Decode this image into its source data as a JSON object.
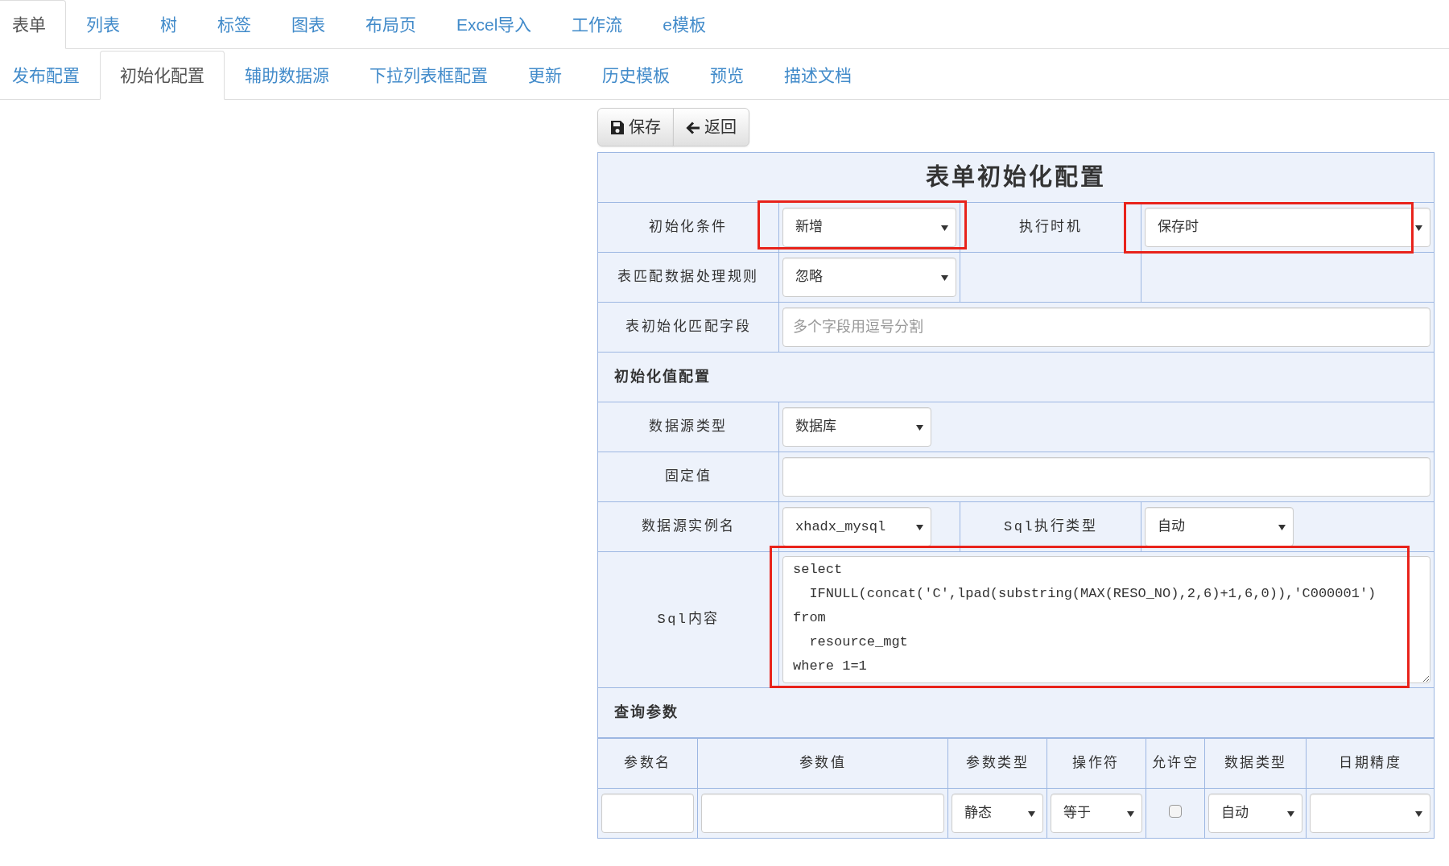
{
  "tabs": [
    {
      "label": "表单",
      "selected": true
    },
    {
      "label": "列表",
      "selected": false
    },
    {
      "label": "树",
      "selected": false
    },
    {
      "label": "标签",
      "selected": false
    },
    {
      "label": "图表",
      "selected": false
    },
    {
      "label": "布局页",
      "selected": false
    },
    {
      "label": "Excel导入",
      "selected": false
    },
    {
      "label": "工作流",
      "selected": false
    },
    {
      "label": "e模板",
      "selected": false
    }
  ],
  "subtabs": [
    {
      "label": "发布配置",
      "selected": false
    },
    {
      "label": "初始化配置",
      "selected": true
    },
    {
      "label": "辅助数据源",
      "selected": false
    },
    {
      "label": "下拉列表框配置",
      "selected": false
    },
    {
      "label": "更新",
      "selected": false
    },
    {
      "label": "历史模板",
      "selected": false
    },
    {
      "label": "预览",
      "selected": false
    },
    {
      "label": "描述文档",
      "selected": false
    }
  ],
  "toolbar": [
    {
      "kind": "save",
      "label": "保存"
    },
    {
      "kind": "back",
      "label": "返回"
    }
  ],
  "form": {
    "title": "表单初始化配置",
    "rows": [
      {
        "kind": "fields",
        "cells": [
          {
            "kind": "label",
            "text": "初始化条件"
          },
          {
            "kind": "select",
            "value": "新增",
            "highlighted": true
          },
          {
            "kind": "label",
            "text": "执行时机"
          },
          {
            "kind": "select",
            "value": "保存时",
            "highlighted": true
          }
        ]
      },
      {
        "kind": "fields",
        "cells": [
          {
            "kind": "label",
            "text": "表匹配数据处理规则"
          },
          {
            "kind": "select",
            "value": "忽略",
            "highlighted": false
          },
          {
            "kind": "blank"
          },
          {
            "kind": "blank"
          }
        ]
      },
      {
        "kind": "fields",
        "cells": [
          {
            "kind": "label",
            "text": "表初始化匹配字段"
          },
          {
            "kind": "input",
            "placeholder": "多个字段用逗号分割",
            "highlighted": false
          }
        ]
      },
      {
        "kind": "section",
        "title": "初始化值配置"
      },
      {
        "kind": "fields",
        "cells": [
          {
            "kind": "label",
            "text": "数据源类型"
          },
          {
            "kind": "select",
            "value": "数据库",
            "highlighted": false
          }
        ]
      },
      {
        "kind": "fields",
        "cells": [
          {
            "kind": "label",
            "text": "固定值"
          },
          {
            "kind": "input",
            "highlighted": false
          }
        ]
      },
      {
        "kind": "fields",
        "cells": [
          {
            "kind": "label",
            "text": "数据源实例名"
          },
          {
            "kind": "select",
            "value": "xhadx_mysql",
            "highlighted": false
          },
          {
            "kind": "label",
            "text": "Sql执行类型"
          },
          {
            "kind": "select",
            "value": "自动",
            "highlighted": false
          }
        ]
      },
      {
        "kind": "fields",
        "cells": [
          {
            "kind": "label",
            "text": "Sql内容"
          },
          {
            "kind": "textarea",
            "value": "select\n  IFNULL(concat('C',lpad(substring(MAX(RESO_NO),2,6)+1,6,0)),'C000001')\nfrom\n  resource_mgt\nwhere 1=1",
            "highlighted": true
          }
        ]
      }
    ]
  },
  "query_params": {
    "title": "查询参数",
    "columns": [
      "参数名",
      "参数值",
      "参数类型",
      "操作符",
      "允许空",
      "数据类型",
      "日期精度"
    ],
    "rows": [
      [
        {
          "kind": "input"
        },
        {
          "kind": "input"
        },
        {
          "kind": "select",
          "value": "静态"
        },
        {
          "kind": "select",
          "value": "等于"
        },
        {
          "kind": "checkbox",
          "checked": false
        },
        {
          "kind": "select",
          "value": "自动"
        },
        {
          "kind": "select"
        }
      ]
    ]
  }
}
